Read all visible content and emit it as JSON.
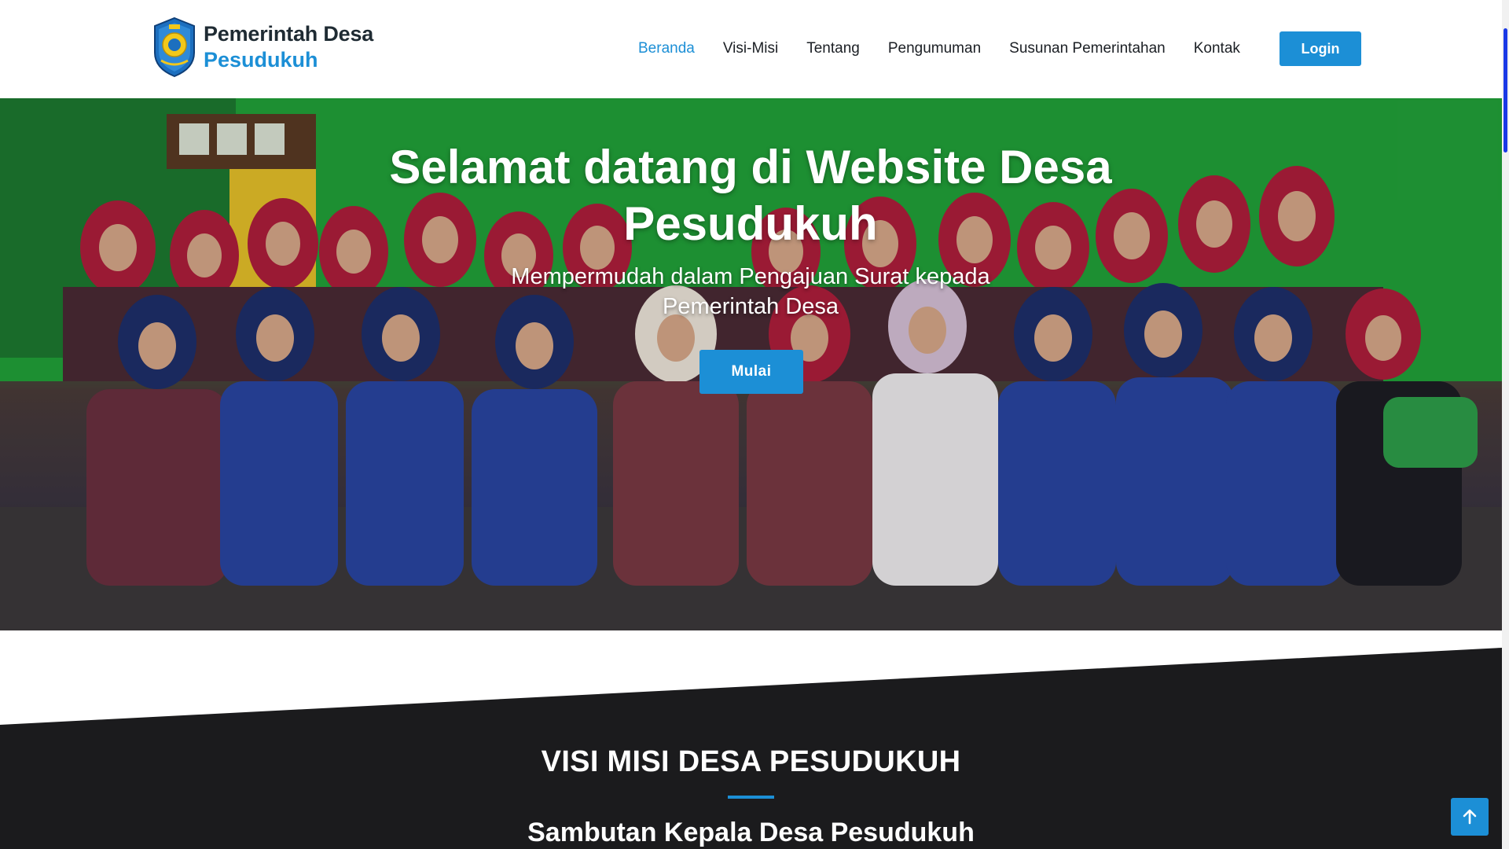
{
  "brand": {
    "title": "Pemerintah Desa",
    "subtitle": "Pesudukuh",
    "logo_icon": "village-emblem-icon"
  },
  "nav": {
    "items": [
      {
        "label": "Beranda",
        "active": true
      },
      {
        "label": "Visi-Misi",
        "active": false
      },
      {
        "label": "Tentang",
        "active": false
      },
      {
        "label": "Pengumuman",
        "active": false
      },
      {
        "label": "Susunan Pemerintahan",
        "active": false
      },
      {
        "label": "Kontak",
        "active": false
      }
    ],
    "login_label": "Login"
  },
  "hero": {
    "title": "Selamat datang di Website Desa Pesudukuh",
    "subtitle": "Mempermudah dalam Pengajuan Surat kepada Pemerintah Desa",
    "button_label": "Mulai"
  },
  "section": {
    "title": "VISI MISI DESA PESUDUKUH",
    "subtitle": "Sambutan Kepala Desa Pesudukuh"
  },
  "scroll_top_icon": "arrow-up-icon",
  "colors": {
    "accent": "#1c8fd6",
    "dark": "#1b1b1d",
    "text": "#1b1f24"
  }
}
